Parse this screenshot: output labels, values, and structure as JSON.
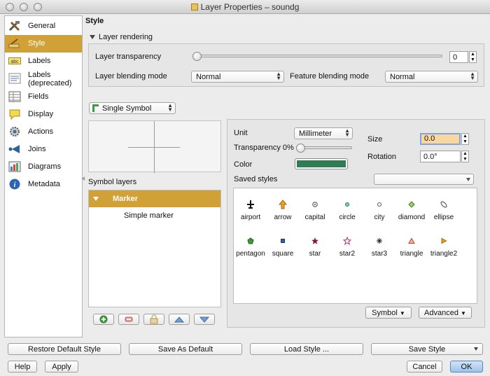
{
  "window": {
    "title": "Layer Properties – soundg"
  },
  "sidebar": {
    "items": [
      {
        "label": "General",
        "icon": "tools-icon"
      },
      {
        "label": "Style",
        "icon": "style-brush-icon"
      },
      {
        "label": "Labels",
        "icon": "abc-label-icon"
      },
      {
        "label": "Labels",
        "label2": "(deprecated)",
        "icon": "label-list-icon"
      },
      {
        "label": "Fields",
        "icon": "table-icon"
      },
      {
        "label": "Display",
        "icon": "speech-bubble-icon"
      },
      {
        "label": "Actions",
        "icon": "gear-icon"
      },
      {
        "label": "Joins",
        "icon": "join-icon"
      },
      {
        "label": "Diagrams",
        "icon": "diagram-icon"
      },
      {
        "label": "Metadata",
        "icon": "info-icon"
      }
    ],
    "selected": "Style"
  },
  "style": {
    "heading": "Style",
    "layer_rendering": {
      "title": "Layer rendering",
      "transparency_label": "Layer transparency",
      "transparency_value": "0",
      "transparency_fraction": 0,
      "blending_label": "Layer blending mode",
      "blending_value": "Normal",
      "feature_blending_label": "Feature blending mode",
      "feature_blending_value": "Normal"
    },
    "renderer": "Single Symbol",
    "symbol_layers": {
      "title": "Symbol layers",
      "root": "Marker",
      "child": "Simple marker"
    },
    "props": {
      "unit_label": "Unit",
      "unit_value": "Millimeter",
      "transparency_label": "Transparency 0%",
      "transparency_fraction": 0,
      "color_label": "Color",
      "color_value": "#2e7d52",
      "size_label": "Size",
      "size_value": "0.0",
      "rotation_label": "Rotation",
      "rotation_value": "0.0°",
      "saved_styles_label": "Saved styles",
      "saved_styles_value": ""
    },
    "symbols": [
      {
        "name": "airport"
      },
      {
        "name": "arrow"
      },
      {
        "name": "capital"
      },
      {
        "name": "circle"
      },
      {
        "name": "city"
      },
      {
        "name": "diamond"
      },
      {
        "name": "ellipse"
      },
      {
        "name": "pentagon"
      },
      {
        "name": "square"
      },
      {
        "name": "star"
      },
      {
        "name": "star2"
      },
      {
        "name": "star3"
      },
      {
        "name": "triangle"
      },
      {
        "name": "triangle2"
      }
    ],
    "symbol_button": "Symbol",
    "advanced_button": "Advanced"
  },
  "footer": {
    "restore": "Restore Default Style",
    "save_default": "Save As Default",
    "load": "Load Style ...",
    "save_style": "Save Style",
    "help": "Help",
    "apply": "Apply",
    "cancel": "Cancel",
    "ok": "OK"
  },
  "colors": {
    "accent": "#d1a137",
    "ok_button": "#b8d2ee",
    "size_highlight": "#fbd7a0"
  }
}
